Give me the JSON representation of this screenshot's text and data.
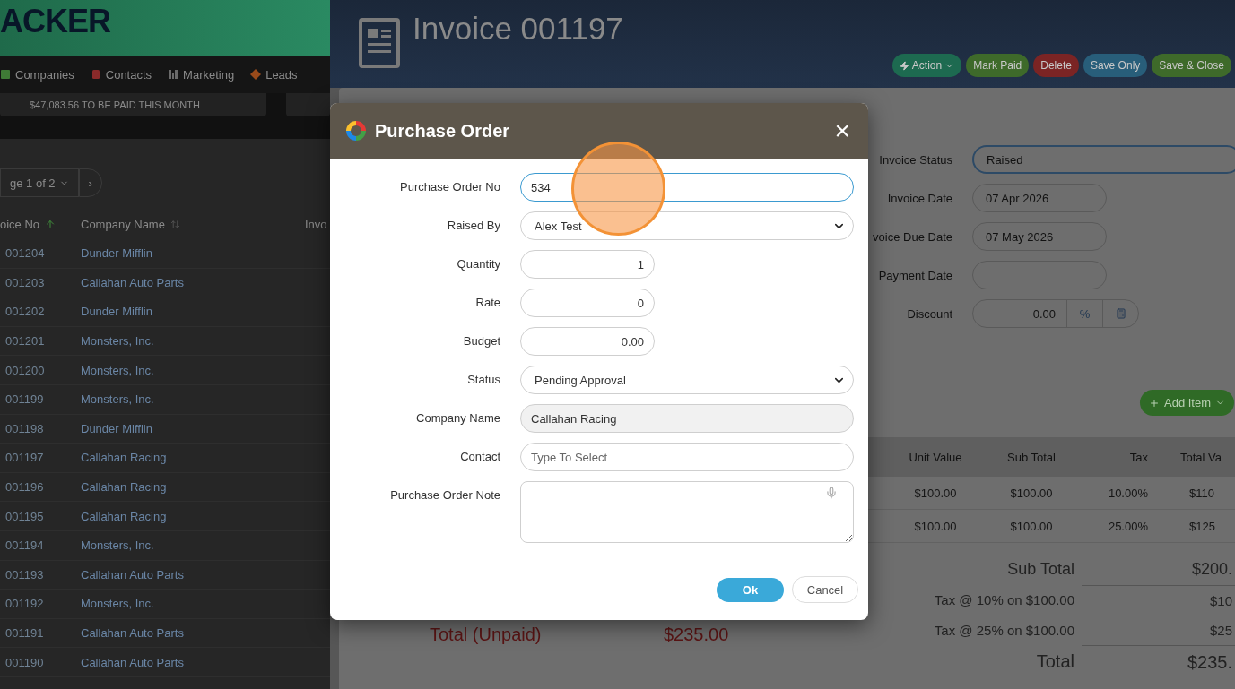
{
  "left_app": {
    "logo": "ACKER",
    "nav": [
      {
        "label": "Companies",
        "color": "#3f7a36"
      },
      {
        "label": "Contacts",
        "color": "#8a2a2a"
      },
      {
        "label": "Marketing",
        "color": "#6a6a6a"
      },
      {
        "label": "Leads",
        "color": "#9a4a1a"
      }
    ],
    "banner": "$47,083.56 TO BE PAID THIS MONTH",
    "pager": {
      "label": "ge 1 of 2",
      "next": "›"
    },
    "table": {
      "columns": [
        "oice No",
        "Company Name",
        "Invo"
      ],
      "rows": [
        [
          "001204",
          "Dunder Mifflin"
        ],
        [
          "001203",
          "Callahan Auto Parts"
        ],
        [
          "001202",
          "Dunder Mifflin"
        ],
        [
          "001201",
          "Monsters, Inc."
        ],
        [
          "001200",
          "Monsters, Inc."
        ],
        [
          "001199",
          "Monsters, Inc."
        ],
        [
          "001198",
          "Dunder Mifflin"
        ],
        [
          "001197",
          "Callahan Racing"
        ],
        [
          "001196",
          "Callahan Racing"
        ],
        [
          "001195",
          "Callahan Racing"
        ],
        [
          "001194",
          "Monsters, Inc."
        ],
        [
          "001193",
          "Callahan Auto Parts"
        ],
        [
          "001192",
          "Monsters, Inc."
        ],
        [
          "001191",
          "Callahan Auto Parts"
        ],
        [
          "001190",
          "Callahan Auto Parts"
        ]
      ]
    }
  },
  "invoice": {
    "title": "Invoice 001197",
    "actions": [
      {
        "label": "Action",
        "kind": "menu",
        "color": "#1d6a50"
      },
      {
        "label": "Mark Paid",
        "kind": "plain",
        "color": "#3e6a2a"
      },
      {
        "label": "Delete",
        "kind": "plain",
        "color": "#7b2424"
      },
      {
        "label": "Save Only",
        "kind": "plain",
        "color": "#285e7a"
      },
      {
        "label": "Save & Close",
        "kind": "plain",
        "color": "#3e6a2a"
      }
    ],
    "fields": [
      {
        "label": "Invoice Status",
        "value": "Raised",
        "kind": "wide",
        "focused": true
      },
      {
        "label": "Invoice Date",
        "value": "07 Apr 2026",
        "kind": "date",
        "focused": false
      },
      {
        "label": "voice Due Date",
        "value": "07 May 2026",
        "kind": "date",
        "focused": false
      },
      {
        "label": "Payment Date",
        "kind": "date",
        "focused": false
      },
      {
        "label": "Discount",
        "value": "0.00",
        "kind": "discount",
        "unit": "%",
        "focused": false
      }
    ],
    "add_item": "Add Item",
    "items": {
      "columns": [
        "Unit Value",
        "Sub Total",
        "Tax",
        "Total Va"
      ],
      "rows": [
        [
          "$100.00",
          "$100.00",
          "10.00%",
          "$110"
        ],
        [
          "$100.00",
          "$100.00",
          "25.00%",
          "$125"
        ]
      ]
    },
    "totals": [
      {
        "label": "Sub Total",
        "value": "$200.",
        "kind": "major"
      },
      {
        "label": "Tax @ 10% on $100.00",
        "value": "$10",
        "kind": "minor"
      },
      {
        "label": "Tax @ 25% on $100.00",
        "value": "$25",
        "kind": "minor"
      },
      {
        "label": "Total",
        "value": "$235.",
        "kind": "grand"
      }
    ],
    "unpaid": {
      "label": "Total (Unpaid)",
      "value": "$235.00"
    }
  },
  "dialog": {
    "title": "Purchase Order",
    "close": "×",
    "fields": [
      {
        "label": "Purchase Order No",
        "kind": "text",
        "value": "534",
        "focused": true,
        "disabled": false
      },
      {
        "label": "Raised By",
        "kind": "select",
        "value": "Alex Test",
        "focused": false,
        "disabled": false
      },
      {
        "label": "Quantity",
        "kind": "number",
        "value": "1",
        "focused": false,
        "disabled": false
      },
      {
        "label": "Rate",
        "kind": "number",
        "value": "0",
        "focused": false,
        "disabled": false
      },
      {
        "label": "Budget",
        "kind": "number",
        "value": "0.00",
        "focused": false,
        "disabled": false
      },
      {
        "label": "Status",
        "kind": "select",
        "value": "Pending Approval",
        "focused": false,
        "disabled": false
      },
      {
        "label": "Company Name",
        "kind": "text",
        "value": "Callahan Racing",
        "focused": false,
        "disabled": true
      },
      {
        "label": "Contact",
        "kind": "text",
        "placeholder": "Type To Select",
        "focused": false,
        "disabled": false
      },
      {
        "label": "Purchase Order Note",
        "kind": "textarea",
        "focused": false,
        "disabled": false
      }
    ],
    "buttons": [
      {
        "label": "Ok",
        "kind": "primary"
      },
      {
        "label": "Cancel",
        "kind": "secondary"
      }
    ]
  }
}
